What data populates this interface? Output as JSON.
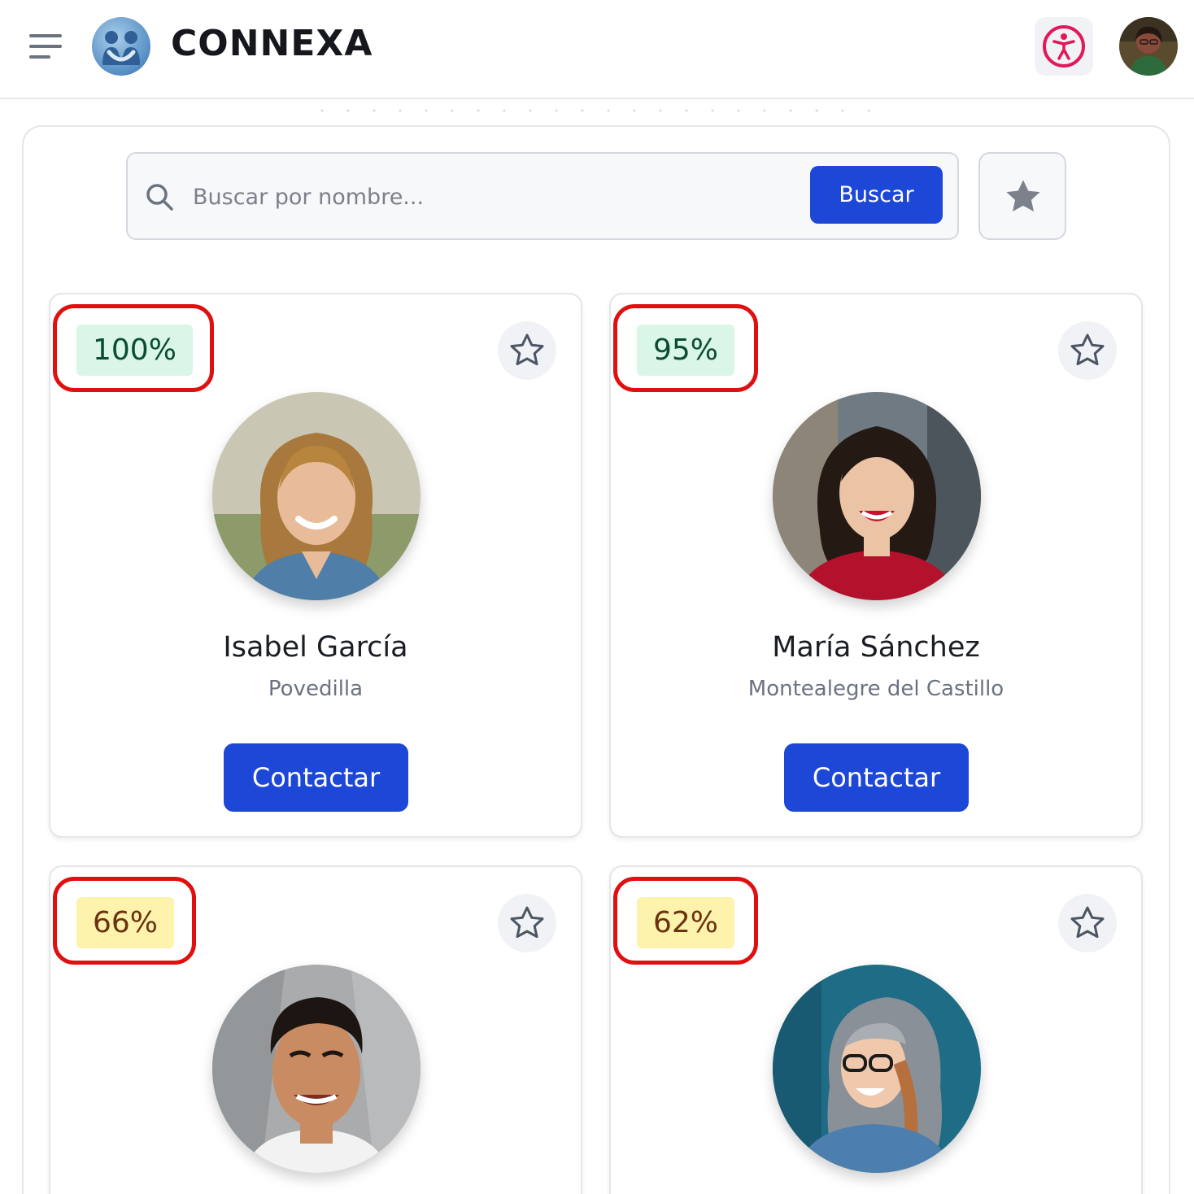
{
  "header": {
    "brand": "CONNEXA",
    "menu_icon": "hamburger-menu-icon",
    "logo_icon": "connexa-logo-icon",
    "accessibility_icon": "accessibility-icon",
    "accent_color": "#1d47d6",
    "accessibility_color": "#e0195a"
  },
  "search": {
    "placeholder": "Buscar por nombre...",
    "value": "",
    "button_label": "Buscar",
    "favorites_icon": "star-filled-icon"
  },
  "profiles": [
    {
      "match": "100%",
      "match_level": "high",
      "name": "Isabel García",
      "location": "Povedilla",
      "contact_label": "Contactar",
      "favorite": false
    },
    {
      "match": "95%",
      "match_level": "high",
      "name": "María Sánchez",
      "location": "Montealegre del Castillo",
      "contact_label": "Contactar",
      "favorite": false
    },
    {
      "match": "66%",
      "match_level": "medium",
      "name": "",
      "location": "",
      "contact_label": "",
      "favorite": false
    },
    {
      "match": "62%",
      "match_level": "medium",
      "name": "",
      "location": "",
      "contact_label": "",
      "favorite": false
    }
  ],
  "badge_colors": {
    "high": {
      "bg": "#daf6e7",
      "text": "#0a4d33"
    },
    "medium": {
      "bg": "#fdf3ad",
      "text": "#6b3210"
    }
  },
  "highlight_color": "#e01010"
}
